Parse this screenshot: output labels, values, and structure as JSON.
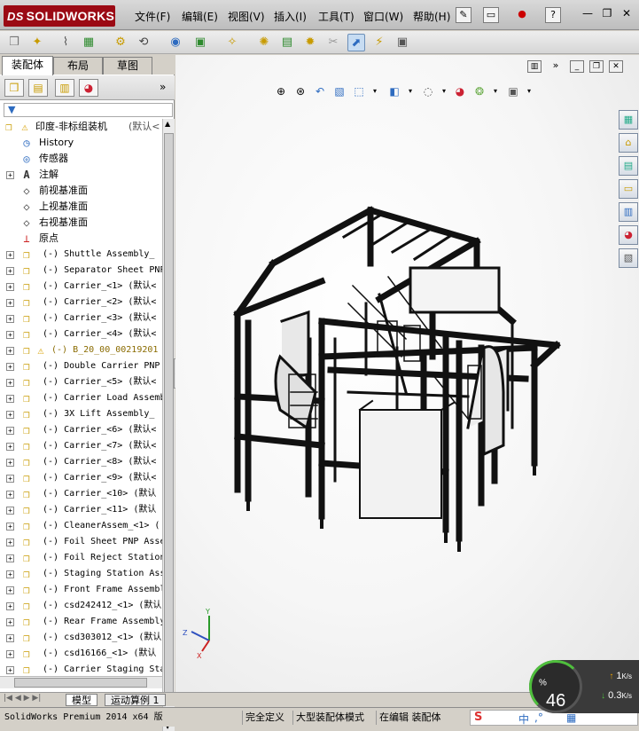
{
  "app": {
    "logo_text": "SOLIDWORKS",
    "logo_prefix": "DS"
  },
  "menu": [
    {
      "label": "文件(F)"
    },
    {
      "label": "编辑(E)"
    },
    {
      "label": "视图(V)"
    },
    {
      "label": "插入(I)"
    },
    {
      "label": "工具(T)"
    },
    {
      "label": "窗口(W)"
    },
    {
      "label": "帮助(H)"
    }
  ],
  "left_tabs": [
    {
      "label": "装配体"
    },
    {
      "label": "布局"
    },
    {
      "label": "草图"
    }
  ],
  "tree": {
    "root_label": "印度-非标组装机",
    "root_config": "(默认<",
    "items": [
      {
        "type": "feature",
        "icon": "history-icon",
        "label": "History"
      },
      {
        "type": "feature",
        "icon": "sensor-icon",
        "label": "传感器"
      },
      {
        "type": "feature",
        "icon": "annotation-icon",
        "label": "注解"
      },
      {
        "type": "plane",
        "icon": "plane-icon",
        "label": "前视基准面"
      },
      {
        "type": "plane",
        "icon": "plane-icon",
        "label": "上视基准面"
      },
      {
        "type": "plane",
        "icon": "plane-icon",
        "label": "右视基准面"
      },
      {
        "type": "origin",
        "icon": "origin-icon",
        "label": "原点"
      },
      {
        "type": "component",
        "label": "(-) Shuttle Assembly_"
      },
      {
        "type": "component",
        "label": "(-) Separator Sheet PNP"
      },
      {
        "type": "component",
        "label": "(-) Carrier_<1> (默认<"
      },
      {
        "type": "component",
        "label": "(-) Carrier_<2> (默认<"
      },
      {
        "type": "component",
        "label": "(-) Carrier_<3> (默认<"
      },
      {
        "type": "component",
        "label": "(-) Carrier_<4> (默认<"
      },
      {
        "type": "warning",
        "label": "(-) B_20_00_00219201"
      },
      {
        "type": "component",
        "label": "(-) Double Carrier PNP"
      },
      {
        "type": "component",
        "label": "(-) Carrier_<5> (默认<"
      },
      {
        "type": "component",
        "label": "(-) Carrier Load Assemb"
      },
      {
        "type": "component",
        "label": "(-) 3X Lift Assembly_"
      },
      {
        "type": "component",
        "label": "(-) Carrier_<6> (默认<"
      },
      {
        "type": "component",
        "label": "(-) Carrier_<7> (默认<"
      },
      {
        "type": "component",
        "label": "(-) Carrier_<8> (默认<"
      },
      {
        "type": "component",
        "label": "(-) Carrier_<9> (默认<"
      },
      {
        "type": "component",
        "label": "(-) Carrier_<10> (默认"
      },
      {
        "type": "component",
        "label": "(-) Carrier_<11> (默认"
      },
      {
        "type": "component",
        "label": "(-) CleanerAssem_<1> ("
      },
      {
        "type": "component",
        "label": "(-) Foil Sheet PNP Asse"
      },
      {
        "type": "component",
        "label": "(-) Foil Reject Station"
      },
      {
        "type": "component",
        "label": "(-) Staging Station Ass"
      },
      {
        "type": "component",
        "label": "(-) Front Frame Assembl"
      },
      {
        "type": "component",
        "label": "(-) csd242412_<1> (默认"
      },
      {
        "type": "component",
        "label": "(-) Rear Frame Assembly"
      },
      {
        "type": "component",
        "label": "(-) csd303012_<1> (默认"
      },
      {
        "type": "component",
        "label": "(-) csd16166_<1> (默认"
      },
      {
        "type": "component",
        "label": "(-) Carrier Staging Sta"
      }
    ]
  },
  "bottom_tabs": [
    {
      "label": "模型"
    },
    {
      "label": "运动算例 1"
    }
  ],
  "status": {
    "product": "SolidWorks Premium 2014 x64 版",
    "state": "完全定义",
    "mode": "大型装配体模式",
    "editing": "在编辑 装配体"
  },
  "speed": {
    "percent": "46",
    "percent_unit": "%",
    "up_value": "1",
    "up_unit": "K/s",
    "down_value": "0.3",
    "down_unit": "K/s"
  },
  "colors": {
    "brand": "#9b0a14",
    "warning": "#f2c400",
    "gauge": "#4fbf3d"
  }
}
